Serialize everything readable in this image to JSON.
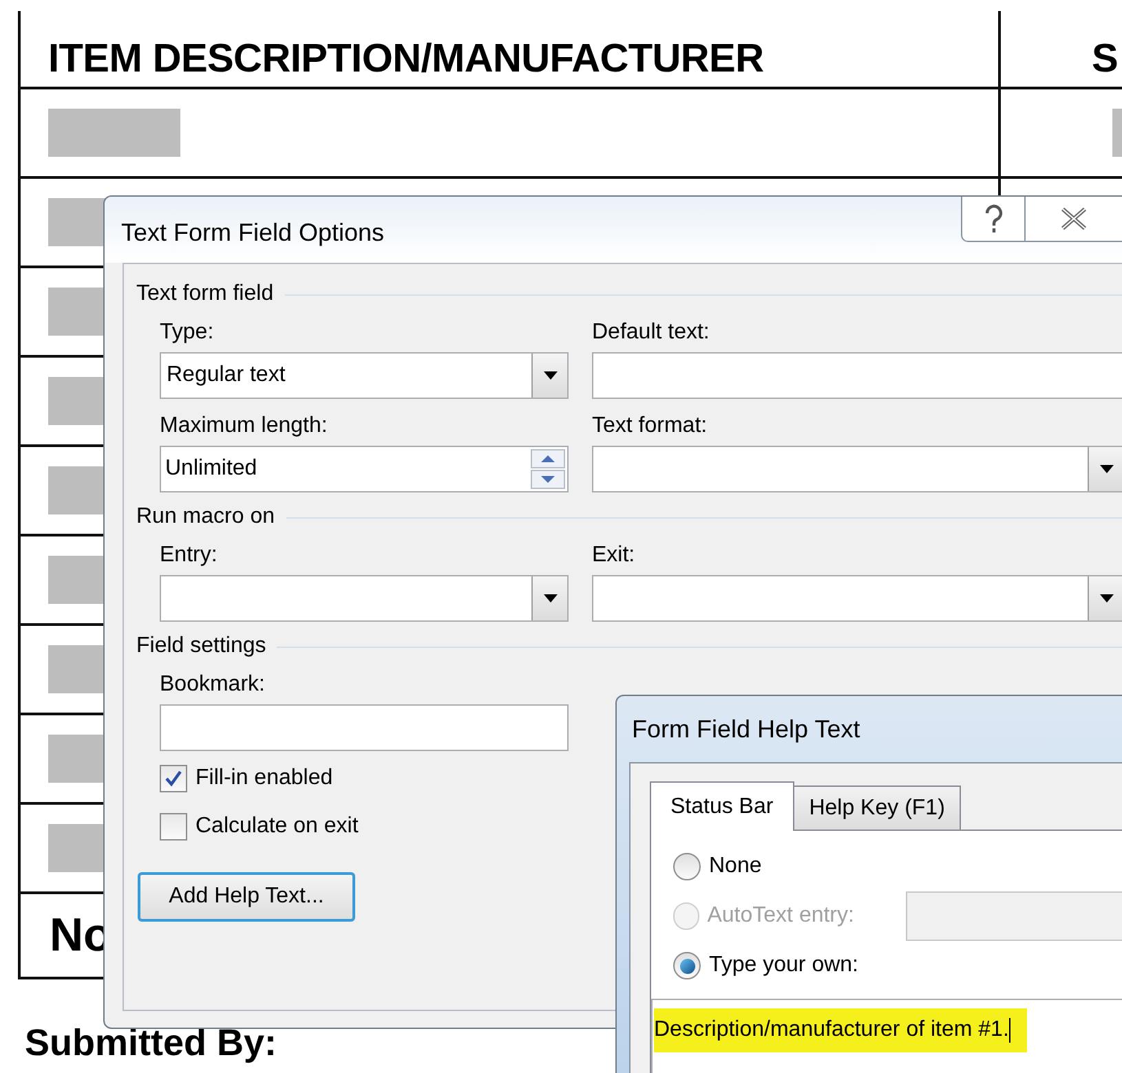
{
  "document": {
    "column_headers": [
      "ITEM DESCRIPTION/MANUFACTURER",
      "S"
    ],
    "row_count_label": "No",
    "submitted_label": "Submitted By:"
  },
  "options_dialog": {
    "title": "Text Form Field Options",
    "sections": [
      {
        "title": "Text form field",
        "fields": [
          {
            "label": "Type:",
            "kind": "dropdown",
            "value": "Regular text"
          },
          {
            "label": "Default text:",
            "kind": "text"
          },
          {
            "label": "Maximum length:",
            "kind": "spin",
            "value": "Unlimited"
          },
          {
            "label": "Text format:",
            "kind": "dropdown"
          }
        ]
      },
      {
        "title": "Run macro on",
        "fields": [
          {
            "label": "Entry:",
            "kind": "dropdown"
          },
          {
            "label": "Exit:",
            "kind": "dropdown"
          }
        ]
      },
      {
        "title": "Field settings",
        "fields": [
          {
            "label": "Bookmark:",
            "kind": "text"
          }
        ]
      }
    ],
    "checkboxes": [
      {
        "label": "Fill-in enabled",
        "checked": true
      },
      {
        "label": "Calculate on exit",
        "checked": false
      }
    ],
    "button": "Add Help Text..."
  },
  "help_dialog": {
    "title": "Form Field Help Text",
    "tabs": [
      {
        "label": "Status Bar",
        "selected": true
      },
      {
        "label": "Help Key (F1)",
        "selected": false
      }
    ],
    "options": [
      {
        "label": "None",
        "selected": false,
        "disabled": false,
        "kind": "plain"
      },
      {
        "label": "AutoText entry:",
        "selected": false,
        "disabled": true,
        "kind": "dropdown"
      },
      {
        "label": "Type your own:",
        "selected": true,
        "disabled": false,
        "kind": "plain"
      }
    ],
    "text_value": "Description/manufacturer of item #1."
  }
}
